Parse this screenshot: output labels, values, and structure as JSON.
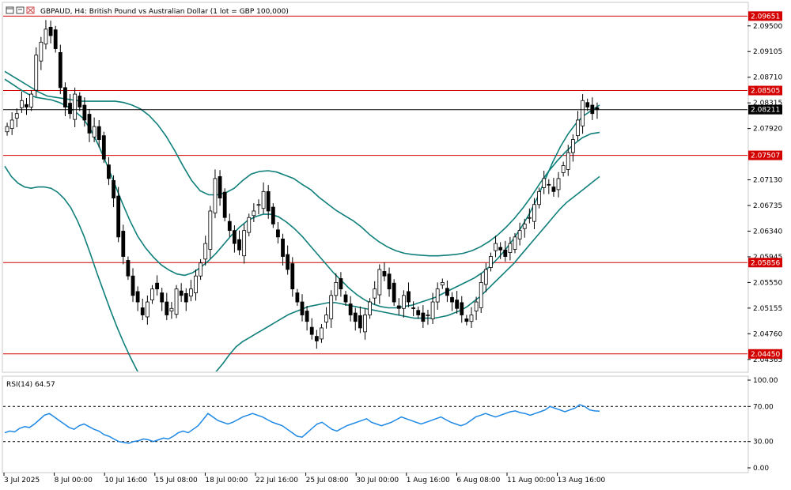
{
  "header": {
    "symbol_text": "GBPAUD, H4:  British Pound vs Australian Dollar (1 lot = GBP 100,000)"
  },
  "colors": {
    "background": "#ffffff",
    "candle": "#000000",
    "bands": "#0f7f7a",
    "support_resistance": "#d40000",
    "current_price_line": "#000000",
    "rsi_line": "#1e88e5"
  },
  "icons": [
    "chart-window-icon",
    "restore-icon",
    "close-icon"
  ],
  "chart_data": [
    {
      "type": "candlestick",
      "instrument": "GBPAUD",
      "timeframe": "H4",
      "ylim": [
        2.0418,
        2.0985
      ],
      "price_ticks": [
        "2.09500",
        "2.09105",
        "2.08710",
        "2.08315",
        "2.07920",
        "2.07130",
        "2.06735",
        "2.06340",
        "2.05945",
        "2.05550",
        "2.05155",
        "2.04760",
        "2.04365"
      ],
      "x_ticks": [
        "3 Jul 2025",
        "8 Jul 00:00",
        "10 Jul 16:00",
        "15 Jul 08:00",
        "18 Jul 00:00",
        "22 Jul 16:00",
        "25 Jul 08:00",
        "30 Jul 00:00",
        "1 Aug 16:00",
        "6 Aug 08:00",
        "11 Aug 00:00",
        "13 Aug 16:00"
      ],
      "horizontal_levels": [
        {
          "value": 2.09651,
          "label": "2.09651"
        },
        {
          "value": 2.08505,
          "label": "2.08505"
        },
        {
          "value": 2.07507,
          "label": "2.07507"
        },
        {
          "value": 2.05856,
          "label": "2.05856"
        },
        {
          "value": 2.0445,
          "label": "2.04450"
        }
      ],
      "current_price": {
        "value": 2.08211,
        "label": "2.08211"
      },
      "close_series": [
        2.0795,
        2.0805,
        2.0815,
        2.0835,
        2.0825,
        2.0845,
        2.0905,
        2.0925,
        2.0945,
        2.0935,
        2.0915,
        2.0855,
        2.0825,
        2.0815,
        2.0845,
        2.0825,
        2.0805,
        2.0785,
        2.0795,
        2.0775,
        2.0745,
        2.0715,
        2.0685,
        2.0625,
        2.0595,
        2.0565,
        2.0535,
        2.0525,
        2.0505,
        2.0525,
        2.0545,
        2.0545,
        2.0525,
        2.0505,
        2.0515,
        2.0545,
        2.0535,
        2.0525,
        2.0545,
        2.0565,
        2.0585,
        2.0615,
        2.0665,
        2.0715,
        2.0685,
        2.0655,
        2.0635,
        2.0615,
        2.0605,
        2.0635,
        2.0655,
        2.0665,
        2.0675,
        2.0695,
        2.0665,
        2.0645,
        2.0625,
        2.0595,
        2.0575,
        2.0545,
        2.0525,
        2.0505,
        2.0495,
        2.0475,
        2.0465,
        2.0485,
        2.0505,
        2.0535,
        2.0555,
        2.0545,
        2.0525,
        2.0505,
        2.0495,
        2.0485,
        2.0505,
        2.0525,
        2.0545,
        2.0575,
        2.0565,
        2.0545,
        2.0525,
        2.0515,
        2.0535,
        2.0525,
        2.0515,
        2.0505,
        2.0495,
        2.0505,
        2.0525,
        2.0545,
        2.0555,
        2.0535,
        2.0525,
        2.0515,
        2.0505,
        2.0495,
        2.0505,
        2.0525,
        2.0555,
        2.0575,
        2.0595,
        2.0615,
        2.0605,
        2.0595,
        2.0615,
        2.0625,
        2.0635,
        2.0645,
        2.0655,
        2.0675,
        2.0695,
        2.0715,
        2.0705,
        2.0695,
        2.0715,
        2.0735,
        2.0755,
        2.0775,
        2.0805,
        2.0835,
        2.0825,
        2.0815,
        2.0821
      ],
      "upper_band": [
        2.088,
        2.0872,
        2.0864,
        2.0856,
        2.0848,
        2.0842,
        2.084,
        2.0838,
        2.0836,
        2.0834,
        2.0834,
        2.0834,
        2.0834,
        2.0834,
        2.0832,
        2.0828,
        2.0822,
        2.0812,
        2.0798,
        2.078,
        2.0758,
        2.0734,
        2.0712,
        2.0696,
        2.069,
        2.069,
        2.0693,
        2.07,
        2.0712,
        2.0722,
        2.0726,
        2.0727,
        2.0725,
        2.072,
        2.0715,
        2.0706,
        2.0698,
        2.0686,
        2.0676,
        2.0666,
        2.0658,
        2.065,
        2.064,
        2.0628,
        2.0618,
        2.061,
        2.0604,
        2.06,
        2.0598,
        2.0597,
        2.0596,
        2.0596,
        2.0597,
        2.0598,
        2.06,
        2.0604,
        2.061,
        2.0618,
        2.0628,
        2.064,
        2.0654,
        2.067,
        2.0688,
        2.0708,
        2.0726,
        2.0742,
        2.0756,
        2.0768,
        2.0778,
        2.0784,
        2.0786
      ],
      "middle_band": [
        2.0868,
        2.086,
        2.0852,
        2.0845,
        2.084,
        2.0838,
        2.0836,
        2.0832,
        2.0826,
        2.0818,
        2.0808,
        2.079,
        2.0766,
        2.0738,
        2.0708,
        2.0678,
        2.065,
        2.0626,
        2.0608,
        2.0594,
        2.0582,
        2.0574,
        2.0568,
        2.0566,
        2.057,
        2.0578,
        2.0588,
        2.06,
        2.0614,
        2.0628,
        2.064,
        2.065,
        2.0656,
        2.066,
        2.066,
        2.0656,
        2.0648,
        2.0638,
        2.0626,
        2.0612,
        2.0598,
        2.0584,
        2.057,
        2.0558,
        2.0546,
        2.0536,
        2.0528,
        2.0522,
        2.0518,
        2.0516,
        2.0516,
        2.0518,
        2.052,
        2.0524,
        2.0528,
        2.0532,
        2.0538,
        2.0544,
        2.055,
        2.0556,
        2.0562,
        2.057,
        2.058,
        2.0592,
        2.0606,
        2.0622,
        2.064,
        2.066,
        2.0684,
        2.0712,
        2.074,
        2.0764,
        2.0784,
        2.08,
        2.0812,
        2.082,
        2.0828
      ],
      "lower_band": [
        2.0734,
        2.0718,
        2.0708,
        2.0702,
        2.07,
        2.0702,
        2.0702,
        2.07,
        2.0694,
        2.0684,
        2.067,
        2.065,
        2.0626,
        2.0598,
        2.0568,
        2.054,
        2.0512,
        2.0486,
        2.0462,
        2.044,
        2.042,
        2.0404,
        2.0392,
        2.0384,
        2.038,
        2.0378,
        2.0378,
        2.038,
        2.0384,
        2.039,
        2.0398,
        2.0408,
        2.0418,
        2.043,
        2.0444,
        2.0456,
        2.0464,
        2.047,
        2.0476,
        2.0482,
        2.0488,
        2.0494,
        2.05,
        2.0506,
        2.051,
        2.0514,
        2.0518,
        2.052,
        2.0522,
        2.0524,
        2.0524,
        2.0522,
        2.052,
        2.0518,
        2.0516,
        2.0514,
        2.0512,
        2.051,
        2.0508,
        2.0506,
        2.0504,
        2.0502,
        2.05,
        2.05,
        2.05,
        2.05,
        2.0502,
        2.0504,
        2.0508,
        2.0512,
        2.0518,
        2.0526,
        2.0534,
        2.0544,
        2.0554,
        2.0564,
        2.0574,
        2.0584,
        2.0596,
        2.0608,
        2.062,
        2.0632,
        2.0644,
        2.0656,
        2.0668,
        2.0678,
        2.0686,
        2.0694,
        2.0702,
        2.071,
        2.0718
      ]
    },
    {
      "type": "line",
      "name": "RSI(14)",
      "title": "RSI(14) 64.57",
      "ylim": [
        0,
        100
      ],
      "y_ticks": [
        "100.00",
        "70.00",
        "30.00",
        "0.00"
      ],
      "levels": [
        70,
        30
      ],
      "last_value": 64.57,
      "values": [
        40,
        42,
        41,
        45,
        47,
        46,
        50,
        55,
        60,
        62,
        58,
        54,
        50,
        46,
        44,
        48,
        50,
        47,
        44,
        42,
        38,
        36,
        33,
        30,
        29,
        28,
        30,
        31,
        33,
        32,
        30,
        32,
        34,
        33,
        36,
        40,
        42,
        40,
        44,
        48,
        55,
        62,
        58,
        54,
        52,
        50,
        52,
        55,
        58,
        60,
        62,
        60,
        58,
        55,
        52,
        50,
        48,
        44,
        40,
        36,
        35,
        40,
        45,
        50,
        52,
        48,
        44,
        42,
        45,
        48,
        50,
        52,
        54,
        56,
        52,
        50,
        48,
        50,
        52,
        55,
        58,
        56,
        54,
        52,
        50,
        52,
        54,
        56,
        58,
        55,
        52,
        50,
        48,
        50,
        54,
        58,
        60,
        62,
        60,
        58,
        60,
        62,
        64,
        65,
        63,
        62,
        60,
        62,
        64,
        66,
        70,
        68,
        66,
        64,
        66,
        68,
        72,
        70,
        66,
        65,
        64.57
      ]
    }
  ]
}
